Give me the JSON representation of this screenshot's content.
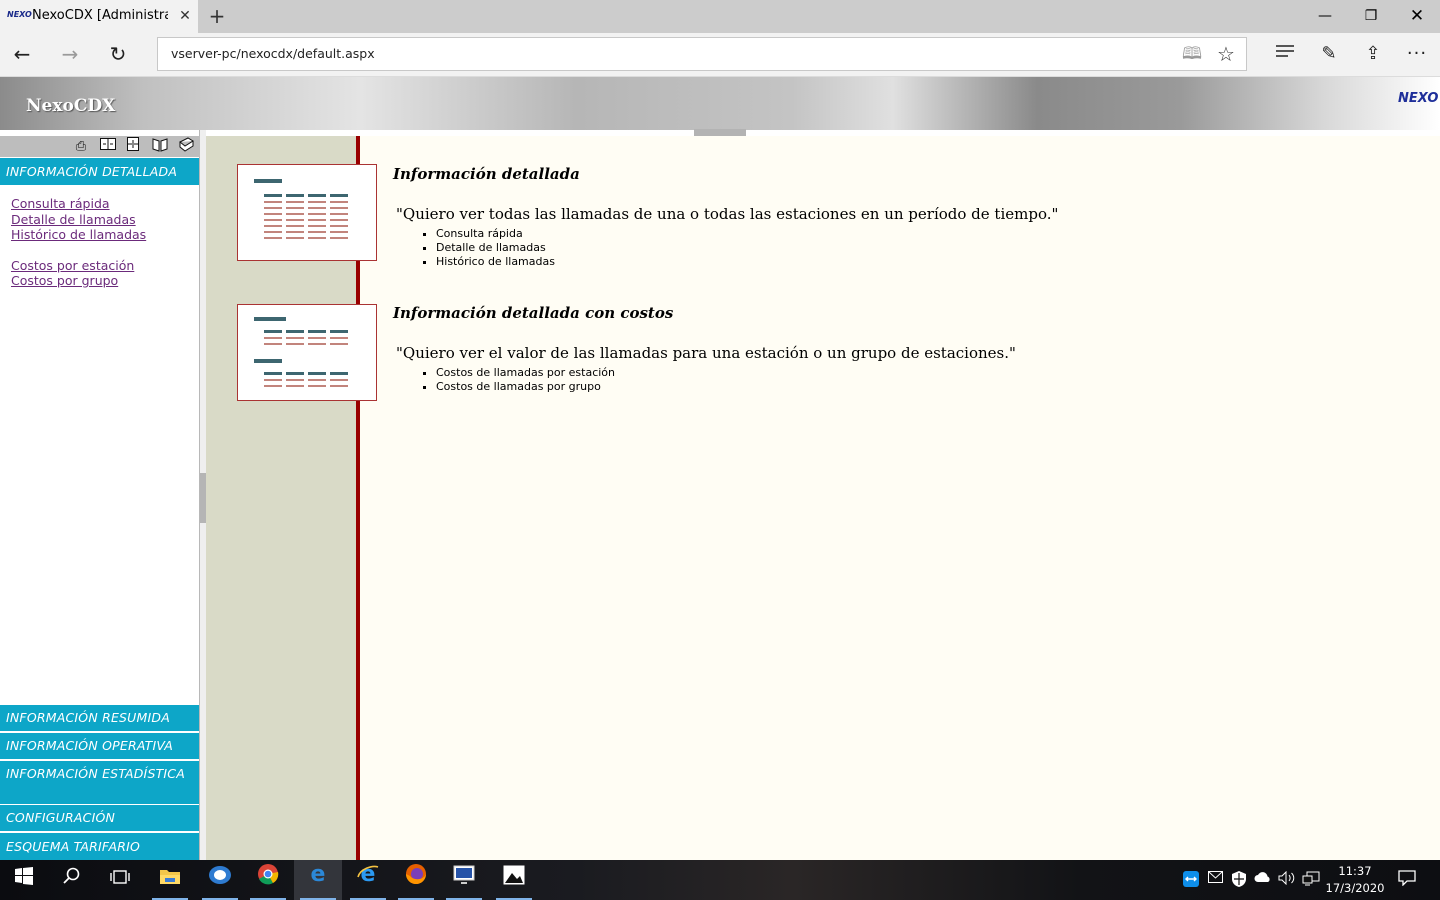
{
  "browser": {
    "tab_title": "NexoCDX [Administrador]",
    "tab_favicon": "NEXO",
    "close_tab": "✕",
    "new_tab": "+",
    "url": "vserver-pc/nexocdx/default.aspx",
    "window_controls": {
      "minimize": "—",
      "maximize": "❐",
      "close": "✕"
    },
    "nav": {
      "back": "←",
      "forward": "→",
      "refresh": "↻"
    },
    "toolbar_icons": [
      "reading-view-icon",
      "favorite-star-icon",
      "hub-icon",
      "web-note-icon",
      "share-icon",
      "more-icon"
    ]
  },
  "header": {
    "app_title": "NexoCDX",
    "logo_text": "NEXO"
  },
  "sidebar": {
    "toolbar_icons": [
      "print-icon",
      "expand-icon",
      "collapse-icon",
      "book-icon",
      "help-icon"
    ],
    "active_section": "INFORMACIÓN DETALLADA",
    "links_group1": [
      "Consulta rápida",
      "Detalle de llamadas",
      "Histórico de llamadas"
    ],
    "links_group2": [
      "Costos por estación",
      "Costos por grupo"
    ],
    "sections": [
      "INFORMACIÓN RESUMIDA",
      "INFORMACIÓN OPERATIVA",
      "INFORMACIÓN ESTADÍSTICA",
      "CONFIGURACIÓN",
      "ESQUEMA TARIFARIO"
    ]
  },
  "content": {
    "blocks": [
      {
        "title": "Información detallada",
        "quote": "\"Quiero ver todas las llamadas de una o todas las estaciones en un período de tiempo.\"",
        "items": [
          "Consulta rápida",
          "Detalle de llamadas",
          "Histórico de llamadas"
        ]
      },
      {
        "title": "Información detallada con costos",
        "quote": "\"Quiero ver el valor de las llamadas para una estación o un grupo de estaciones.\"",
        "items": [
          "Costos de llamadas por estación",
          "Costos de llamadas por grupo"
        ]
      }
    ]
  },
  "taskbar": {
    "apps": [
      "start-icon",
      "search-icon",
      "task-view-icon",
      "file-explorer-icon",
      "outlook-icon",
      "chrome-icon",
      "edge-icon",
      "internet-explorer-icon",
      "firefox-icon",
      "remote-desktop-icon",
      "photos-icon"
    ],
    "tray": [
      "teamviewer-icon",
      "mail-icon",
      "defender-icon",
      "onedrive-icon",
      "volume-icon",
      "network-icon"
    ],
    "time": "11:37",
    "date": "17/3/2020"
  },
  "colors": {
    "menu_header": "#0da6c8",
    "content_rule": "#990000",
    "content_bg": "#fffdf4",
    "content_sidebar_bg": "#d9dac7",
    "link_visited": "#6b2a7b"
  }
}
